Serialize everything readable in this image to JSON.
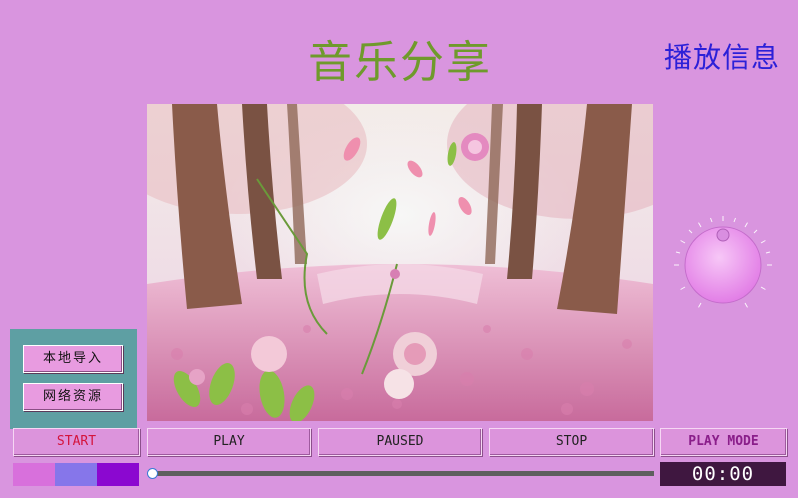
{
  "header": {
    "title": "音乐分享",
    "info_label": "播放信息"
  },
  "side_panel": {
    "local_import_label": "本地导入",
    "network_resources_label": "网络资源"
  },
  "controls": {
    "start_label": "START",
    "play_label": "PLAY",
    "paused_label": "PAUSED",
    "stop_label": "STOP",
    "play_mode_label": "PLAY MODE"
  },
  "colors": {
    "background": "#d995df",
    "title": "#6f9a2c",
    "info": "#2b20d8",
    "start_text": "#d4143c",
    "play_mode_text": "#8a1e8a",
    "swatch_1": "#d870dc",
    "swatch_2": "#8676ea",
    "swatch_3": "#8b08d0"
  },
  "playback": {
    "time_display": "00:00",
    "progress": 0
  },
  "volume_knob": {
    "icon": "knob-icon"
  },
  "scene": {
    "icon": "blossom-forest-image"
  }
}
